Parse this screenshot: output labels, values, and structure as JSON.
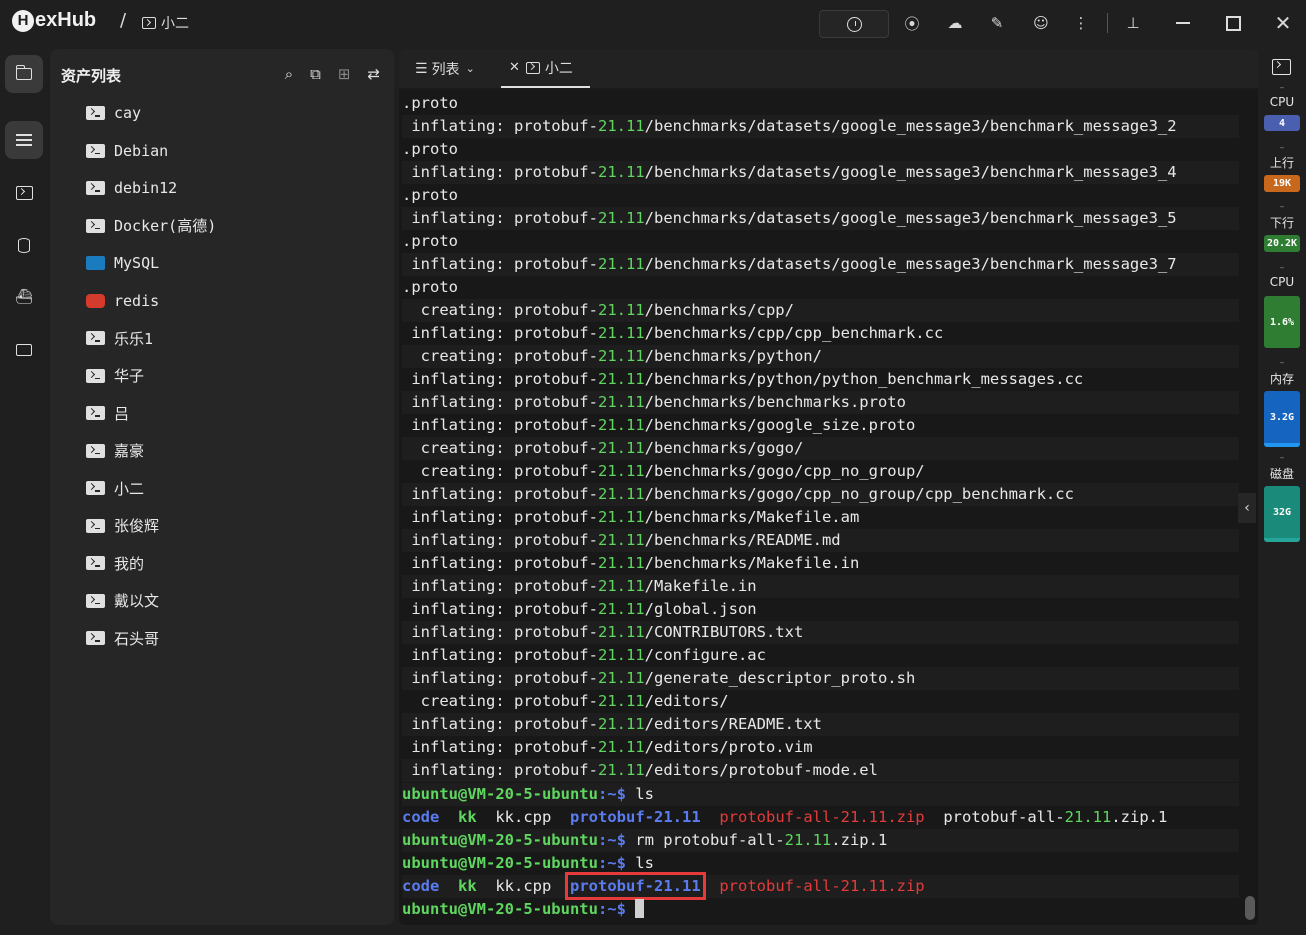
{
  "app": {
    "name": "exHub",
    "logo_letter": "H",
    "separator": "/",
    "active_session": "小二"
  },
  "titlebar": {
    "icons": [
      "sync-icon",
      "wifi-icon",
      "cloud-sync-icon",
      "magic-icon",
      "user-icon",
      "more-icon",
      "pin-icon",
      "minimize-icon",
      "maximize-icon",
      "close-icon"
    ]
  },
  "leftbar": {
    "items": [
      "folder-icon",
      "list-icon",
      "terminal-icon",
      "database-icon",
      "docker-icon",
      "remote-desktop-icon"
    ]
  },
  "assets": {
    "title": "资产列表",
    "items": [
      {
        "name": "cay",
        "kind": "ssh"
      },
      {
        "name": "Debian",
        "kind": "ssh"
      },
      {
        "name": "debin12",
        "kind": "ssh"
      },
      {
        "name": "Docker(高德)",
        "kind": "ssh"
      },
      {
        "name": "MySQL",
        "kind": "mysql"
      },
      {
        "name": "redis",
        "kind": "redis"
      },
      {
        "name": "乐乐1",
        "kind": "ssh"
      },
      {
        "name": "华子",
        "kind": "ssh"
      },
      {
        "name": "吕",
        "kind": "ssh"
      },
      {
        "name": "嘉豪",
        "kind": "ssh"
      },
      {
        "name": "小二",
        "kind": "ssh"
      },
      {
        "name": "张俊辉",
        "kind": "ssh"
      },
      {
        "name": "我的",
        "kind": "ssh"
      },
      {
        "name": "戴以文",
        "kind": "ssh"
      },
      {
        "name": "石头哥",
        "kind": "ssh"
      }
    ]
  },
  "tabs": {
    "list_label": "列表",
    "active_label": "小二"
  },
  "terminal": {
    "unzip_lines": [
      {
        "pre": ".proto",
        "action": "",
        "path": ""
      },
      {
        "action": " inflating: ",
        "path": "/benchmarks/datasets/google_message3/benchmark_message3_2"
      },
      {
        "pre": ".proto",
        "action": "",
        "path": ""
      },
      {
        "action": " inflating: ",
        "path": "/benchmarks/datasets/google_message3/benchmark_message3_4"
      },
      {
        "pre": ".proto",
        "action": "",
        "path": ""
      },
      {
        "action": " inflating: ",
        "path": "/benchmarks/datasets/google_message3/benchmark_message3_5"
      },
      {
        "pre": ".proto",
        "action": "",
        "path": ""
      },
      {
        "action": " inflating: ",
        "path": "/benchmarks/datasets/google_message3/benchmark_message3_7"
      },
      {
        "pre": ".proto",
        "action": "",
        "path": ""
      },
      {
        "action": "  creating: ",
        "path": "/benchmarks/cpp/"
      },
      {
        "action": " inflating: ",
        "path": "/benchmarks/cpp/cpp_benchmark.cc"
      },
      {
        "action": "  creating: ",
        "path": "/benchmarks/python/"
      },
      {
        "action": " inflating: ",
        "path": "/benchmarks/python/python_benchmark_messages.cc"
      },
      {
        "action": " inflating: ",
        "path": "/benchmarks/benchmarks.proto"
      },
      {
        "action": " inflating: ",
        "path": "/benchmarks/google_size.proto"
      },
      {
        "action": "  creating: ",
        "path": "/benchmarks/gogo/"
      },
      {
        "action": "  creating: ",
        "path": "/benchmarks/gogo/cpp_no_group/"
      },
      {
        "action": " inflating: ",
        "path": "/benchmarks/gogo/cpp_no_group/cpp_benchmark.cc"
      },
      {
        "action": " inflating: ",
        "path": "/benchmarks/Makefile.am"
      },
      {
        "action": " inflating: ",
        "path": "/benchmarks/README.md"
      },
      {
        "action": " inflating: ",
        "path": "/benchmarks/Makefile.in"
      },
      {
        "action": " inflating: ",
        "path": "/Makefile.in"
      },
      {
        "action": " inflating: ",
        "path": "/global.json"
      },
      {
        "action": " inflating: ",
        "path": "/CONTRIBUTORS.txt"
      },
      {
        "action": " inflating: ",
        "path": "/configure.ac"
      },
      {
        "action": " inflating: ",
        "path": "/generate_descriptor_proto.sh"
      },
      {
        "action": "  creating: ",
        "path": "/editors/"
      },
      {
        "action": " inflating: ",
        "path": "/editors/README.txt"
      },
      {
        "action": " inflating: ",
        "path": "/editors/proto.vim"
      },
      {
        "action": " inflating: ",
        "path": "/editors/protobuf-mode.el"
      }
    ],
    "pkg_prefix": "protobuf-",
    "pkg_version": "21.11",
    "prompt_user": "ubuntu@VM-20-5-ubuntu",
    "prompt_path": ":~$",
    "cmd_ls": " ls",
    "cmd_rm_prefix": " rm protobuf-all-",
    "cmd_rm_suffix": ".zip.1",
    "ls1": {
      "code": "code",
      "kk": "kk",
      "kkcpp": "kk.cpp",
      "dir": "protobuf-21.11",
      "zip": "protobuf-all-21.11.zip",
      "zip1_prefix": "protobuf-all-",
      "zip1_suffix": ".zip.1"
    },
    "ls2": {
      "code": "code",
      "kk": "kk",
      "kkcpp": "kk.cpp",
      "dir": "protobuf-21.11",
      "zip": "protobuf-all-21.11.zip"
    }
  },
  "monitor": {
    "cpu_label": "CPU",
    "cpu_cores": "4",
    "up_label": "上行",
    "up_value": "19K",
    "down_label": "下行",
    "down_value": "20.2K",
    "cpu_usage_label": "CPU",
    "cpu_usage": "1.6%",
    "mem_label": "内存",
    "mem_value": "3.2G",
    "disk_label": "磁盘",
    "disk_value": "32G",
    "colors": {
      "cores": "#4a5fb0",
      "up": "#c8681c",
      "down": "#2e7d32",
      "cpu": "#2e7d32",
      "mem": "#1565c0",
      "disk": "#1a8a7a"
    }
  }
}
